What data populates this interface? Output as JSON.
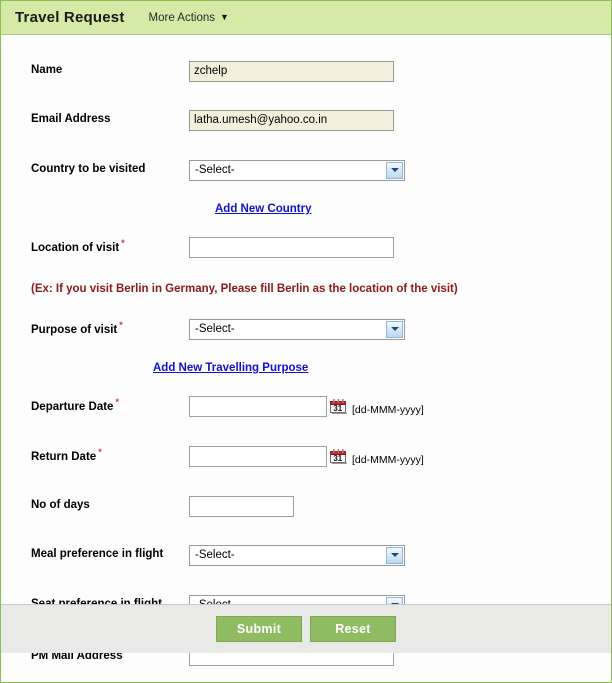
{
  "header": {
    "title": "Travel Request",
    "more_actions_label": "More Actions",
    "caret_icon": "chevron-down-icon",
    "bg_color": "#d4eaa6"
  },
  "form": {
    "required_marker": "*",
    "fields": [
      {
        "label": "Name",
        "type": "text",
        "value": "zchelp",
        "required": false,
        "filled": true
      },
      {
        "label": "Email Address",
        "type": "text",
        "value": "latha.umesh@yahoo.co.in",
        "required": false,
        "filled": true
      },
      {
        "label": "Country to be visited",
        "type": "select",
        "value": "-Select-",
        "required": false
      },
      {
        "label": "Location of visit",
        "type": "text",
        "value": "",
        "required": true,
        "filled": false
      },
      {
        "label": "Purpose of visit",
        "type": "select",
        "value": "-Select-",
        "required": true
      },
      {
        "label": "Departure Date",
        "type": "date",
        "value": "",
        "required": true,
        "format_hint": "[dd-MMM-yyyy]",
        "calendar_icon": "calendar-icon",
        "calendar_day": "31"
      },
      {
        "label": "Return Date",
        "type": "date",
        "value": "",
        "required": true,
        "format_hint": "[dd-MMM-yyyy]",
        "calendar_icon": "calendar-icon",
        "calendar_day": "31"
      },
      {
        "label": "No of days",
        "type": "text",
        "value": "",
        "required": false,
        "filled": false
      },
      {
        "label": "Meal preference in flight",
        "type": "select",
        "value": "-Select-",
        "required": false
      },
      {
        "label": "Seat preference in flight",
        "type": "select",
        "value": "-Select-",
        "required": false
      },
      {
        "label": "PM Mail Address",
        "type": "text",
        "value": "",
        "required": true,
        "filled": false
      }
    ],
    "links": {
      "add_country": "Add New Country",
      "add_purpose": "Add New Travelling Purpose"
    },
    "hints": {
      "location_example": "(Ex: If you visit Berlin in Germany, Please fill Berlin as the location of the visit)"
    }
  },
  "footer": {
    "submit_label": "Submit",
    "reset_label": "Reset",
    "button_color": "#8fbc62"
  }
}
